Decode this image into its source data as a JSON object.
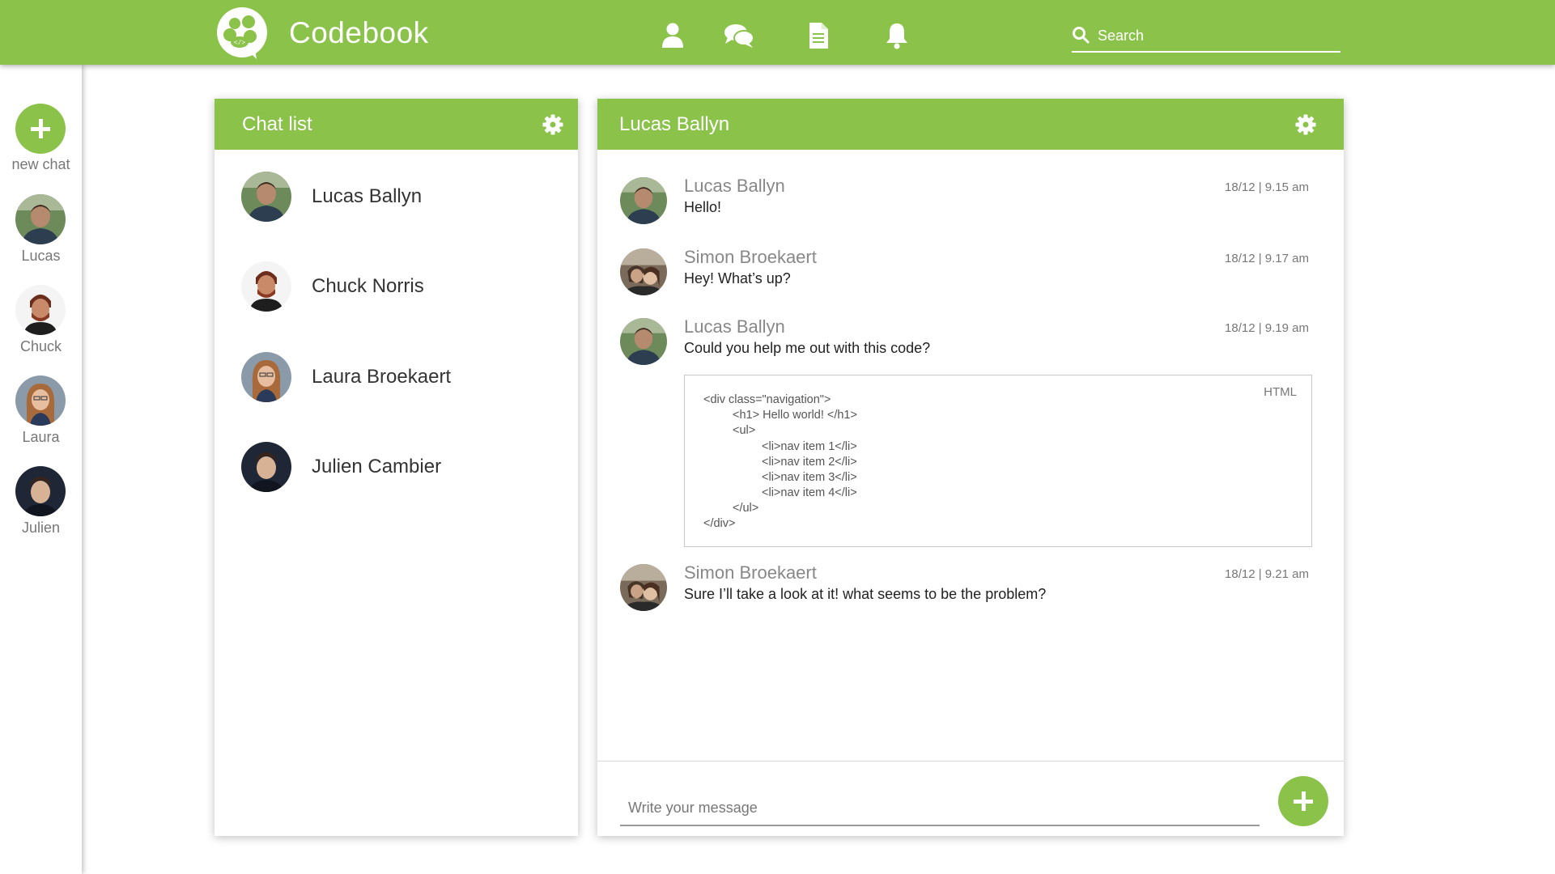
{
  "header": {
    "brand": "Codebook",
    "nav": [
      "profile-icon",
      "chat-icon",
      "document-icon",
      "bell-icon"
    ],
    "search_placeholder": "Search"
  },
  "rail": {
    "new_chat_label": "new chat",
    "contacts": [
      {
        "label": "Lucas"
      },
      {
        "label": "Chuck"
      },
      {
        "label": "Laura"
      },
      {
        "label": "Julien"
      }
    ]
  },
  "chat_list": {
    "title": "Chat list",
    "items": [
      {
        "name": "Lucas Ballyn"
      },
      {
        "name": "Chuck Norris"
      },
      {
        "name": "Laura Broekaert"
      },
      {
        "name": "Julien Cambier"
      }
    ]
  },
  "conversation": {
    "title": "Lucas Ballyn",
    "messages": [
      {
        "sender": "Lucas Ballyn",
        "time": "18/12 | 9.15 am",
        "text": "Hello!"
      },
      {
        "sender": "Simon Broekaert",
        "time": "18/12 | 9.17 am",
        "text": "Hey! What’s up?"
      },
      {
        "sender": "Lucas Ballyn",
        "time": "18/12 | 9.19 am",
        "text": "Could you help me out with this code?"
      },
      {
        "sender": "Simon Broekaert",
        "time": "18/12 | 9.21 am",
        "text": "Sure I’ll take a look at it! what seems to be the problem?"
      }
    ],
    "code": {
      "language": "HTML",
      "lines": [
        "<div class=\"navigation\">",
        "<h1> Hello world! </h1>",
        "<ul>",
        "<li>nav item 1</li>",
        "<li>nav item 2</li>",
        "<li>nav item 3</li>",
        "<li>nav item 4</li>",
        "</ul>",
        "</div>"
      ]
    },
    "compose_placeholder": "Write your message"
  },
  "colors": {
    "accent": "#8bc34a",
    "text": "#333333",
    "muted": "#888888"
  }
}
